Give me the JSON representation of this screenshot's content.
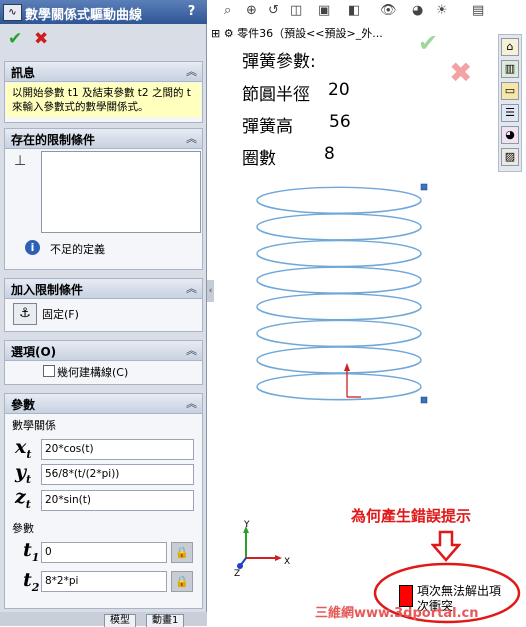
{
  "property_manager": {
    "title": "數學關係式驅動曲線",
    "help_glyph": "?",
    "ok_glyph": "✔",
    "cancel_glyph": "✖",
    "message": {
      "header": "訊息",
      "text": "以開始參數 t1 及結束參數 t2 之間的 t 來輸入參數式的數學關係式。"
    },
    "existing_relations": {
      "header": "存在的限制條件",
      "status": "不足的定義"
    },
    "add_relations": {
      "header": "加入限制條件",
      "fix_label": "固定(F)"
    },
    "options": {
      "header": "選項(O)",
      "construction_label": "幾何建構線(C)"
    },
    "parameters": {
      "header": "參數",
      "equation_label": "數學關係",
      "xt": "20*cos(t)",
      "yt": "56/8*(t/(2*pi))",
      "zt": "20*sin(t)",
      "param_label": "參數",
      "t1": "0",
      "t2": "8*2*pi"
    },
    "bottom_tabs": [
      "模型",
      "動畫1"
    ]
  },
  "feature_tree": {
    "part_name": "零件36（預設<<預設>_外..."
  },
  "viewport": {
    "notes": {
      "title": "彈簧參數:",
      "pitch_radius_label": "節圓半徑",
      "pitch_radius": "20",
      "height_label": "彈簧高",
      "height": "56",
      "turns_label": "圈數",
      "turns": "8"
    },
    "warning_caption": "為何產生錯誤提示",
    "rebuild_message": "項次無法解出項次衝突",
    "watermark": "三維網www.3dportal.cn",
    "triad": {
      "x": "X",
      "y": "Y",
      "z": "Z"
    }
  },
  "helix": {
    "turns": 8
  },
  "colors": {
    "helix": "#6fa8d8",
    "warning": "#e01818",
    "title_bar": "#2f5595",
    "message_bg": "#ffffbe"
  }
}
